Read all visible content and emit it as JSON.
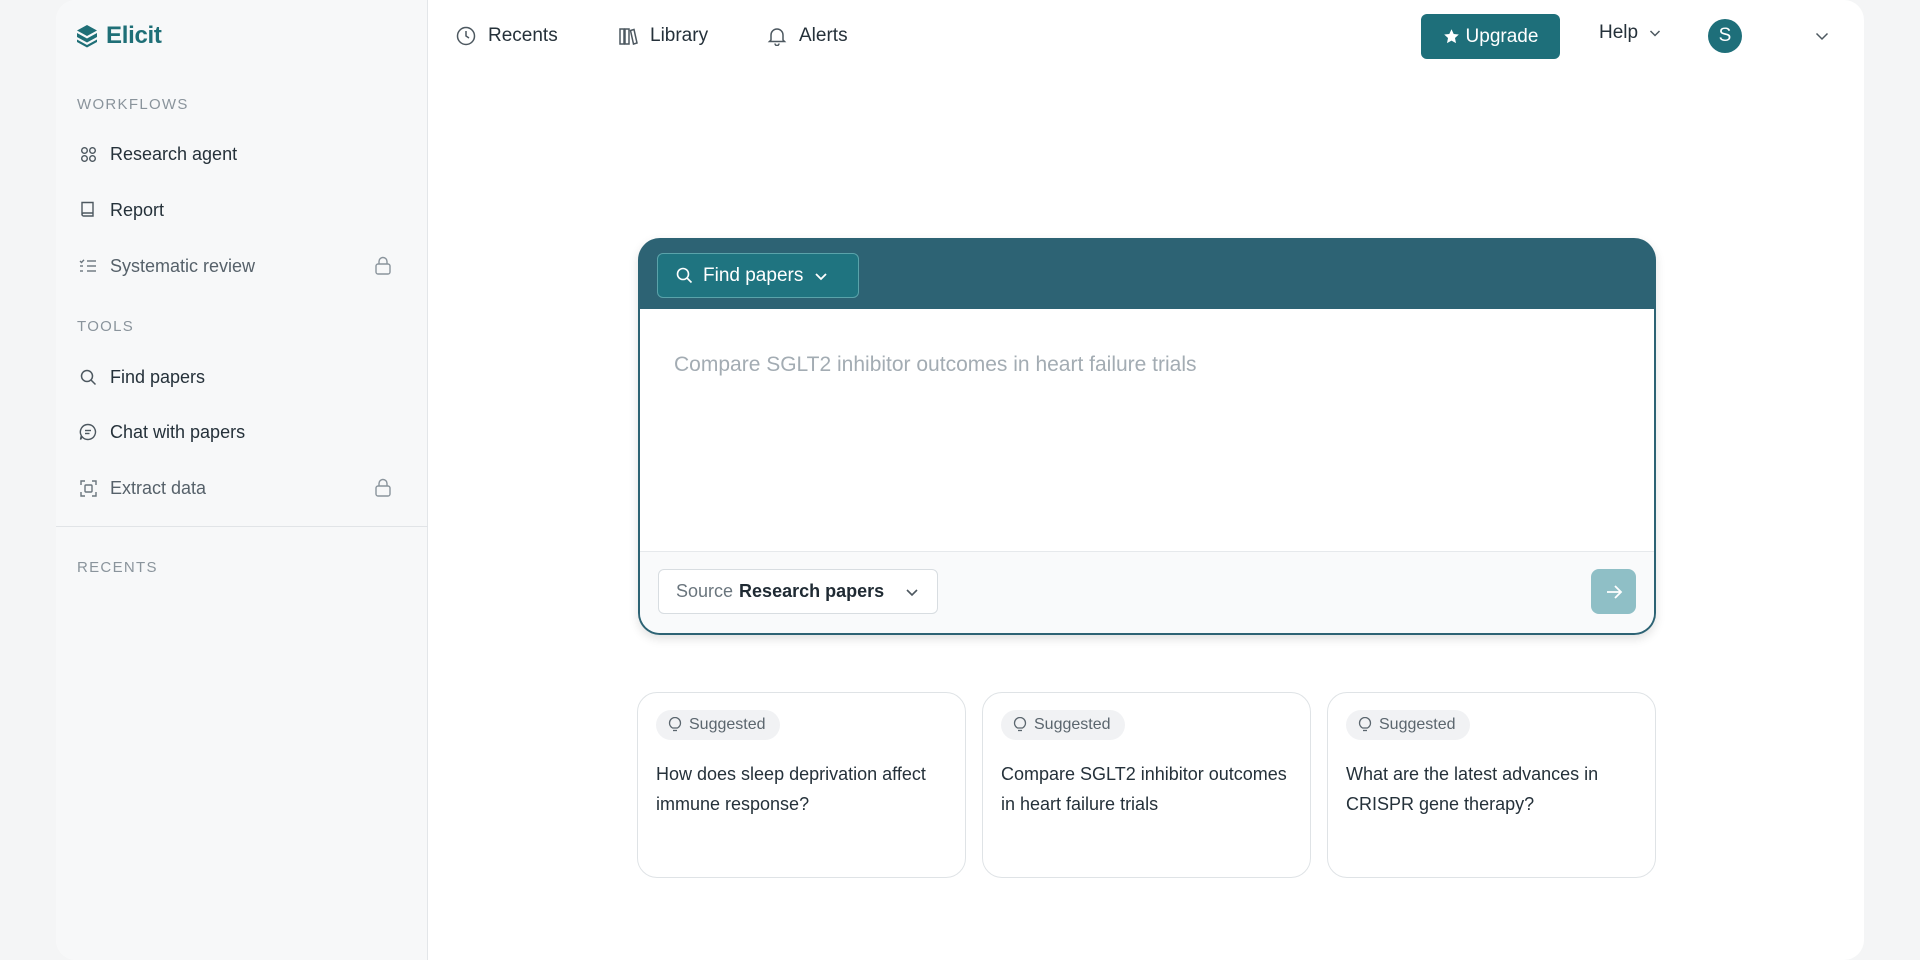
{
  "app": {
    "name": "Elicit",
    "brand_color": "#1e6f7a"
  },
  "sidebar": {
    "workflows_title": "WORKFLOWS",
    "workflows": [
      {
        "label": "Research agent",
        "icon": "research-agent-icon",
        "locked": false
      },
      {
        "label": "Report",
        "icon": "report-icon",
        "locked": false
      },
      {
        "label": "Systematic review",
        "icon": "checklist-icon",
        "locked": true
      }
    ],
    "tools_title": "TOOLS",
    "tools": [
      {
        "label": "Find papers",
        "icon": "search-icon",
        "locked": false
      },
      {
        "label": "Chat with papers",
        "icon": "chat-icon",
        "locked": false
      },
      {
        "label": "Extract data",
        "icon": "extract-icon",
        "locked": true
      }
    ],
    "recents_title": "RECENTS"
  },
  "topnav": {
    "items": [
      {
        "label": "Recents",
        "icon": "clock-icon"
      },
      {
        "label": "Library",
        "icon": "library-icon"
      },
      {
        "label": "Alerts",
        "icon": "bell-icon"
      }
    ],
    "upgrade_label": "Upgrade",
    "help_label": "Help",
    "avatar_initial": "S"
  },
  "search": {
    "mode_label": "Find papers",
    "placeholder": "Compare SGLT2 inhibitor outcomes in heart failure trials",
    "source_key": "Source",
    "source_value": "Research papers"
  },
  "suggestions": {
    "badge_label": "Suggested",
    "items": [
      "How does sleep deprivation affect immune response?",
      "Compare SGLT2 inhibitor outcomes in heart failure trials",
      "What are the latest advances in CRISPR gene therapy?"
    ]
  }
}
